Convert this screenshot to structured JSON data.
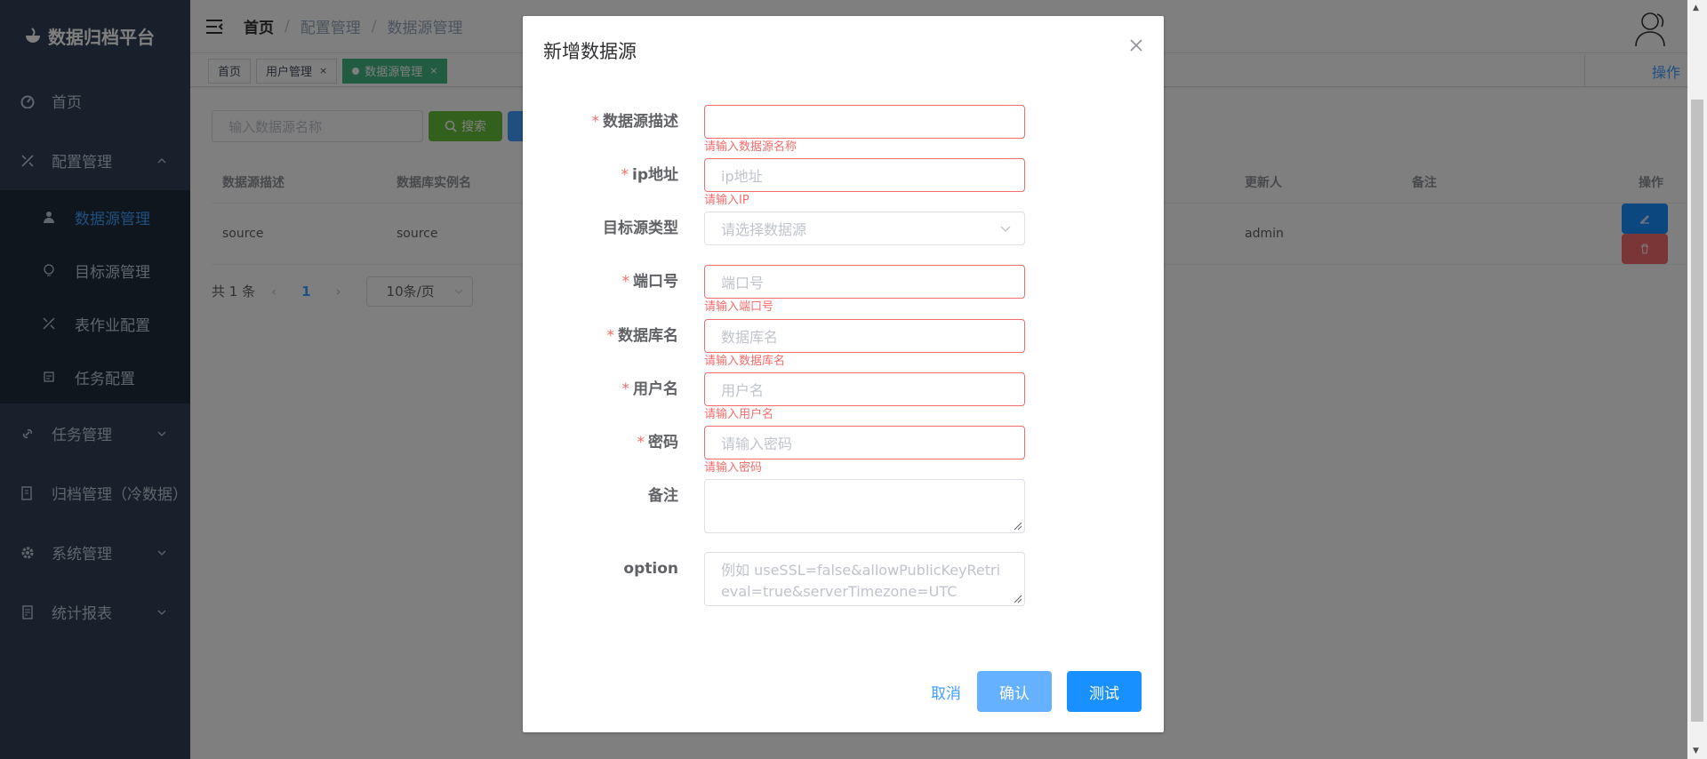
{
  "app": {
    "title": "数据归档平台"
  },
  "sidebar": {
    "items": [
      {
        "label": "首页",
        "icon": "dashboard-icon"
      },
      {
        "label": "配置管理",
        "icon": "tools-icon"
      },
      {
        "label": "任务管理",
        "icon": "link-icon"
      },
      {
        "label": "归档管理（冷数据）",
        "icon": "archive-icon"
      },
      {
        "label": "系统管理",
        "icon": "gear-icon"
      },
      {
        "label": "统计报表",
        "icon": "report-icon"
      }
    ],
    "submenu": [
      {
        "label": "数据源管理",
        "icon": "user-icon",
        "active": true
      },
      {
        "label": "目标源管理",
        "icon": "target-icon"
      },
      {
        "label": "表作业配置",
        "icon": "tools-icon"
      },
      {
        "label": "任务配置",
        "icon": "task-icon"
      }
    ]
  },
  "navbar": {
    "breadcrumb": [
      "首页",
      "配置管理",
      "数据源管理"
    ],
    "separator": "/"
  },
  "tags": {
    "items": [
      "首页",
      "用户管理",
      "数据源管理"
    ],
    "close": "×",
    "right_label": "操作"
  },
  "content": {
    "search_placeholder": "输入数据源名称",
    "search_button": "搜索",
    "table": {
      "headers": [
        "数据源描述",
        "数据库实例名",
        "更新人",
        "备注",
        "操作"
      ],
      "rows": [
        {
          "desc": "source",
          "instance": "source",
          "updater": "admin",
          "remark": ""
        }
      ]
    },
    "pagination": {
      "total": "共 1 条",
      "prev": "‹",
      "page": "1",
      "next": "›",
      "size": "10条/页"
    }
  },
  "dialog": {
    "title": "新增数据源",
    "close": "×",
    "fields": {
      "desc": {
        "label": "数据源描述",
        "required": "*",
        "value": "",
        "error": "请输入数据源名称"
      },
      "ip": {
        "label": "ip地址",
        "required": "*",
        "placeholder": "ip地址",
        "error": "请输入IP"
      },
      "type": {
        "label": "目标源类型",
        "placeholder": "请选择数据源"
      },
      "port": {
        "label": "端口号",
        "required": "*",
        "placeholder": "端口号",
        "error": "请输入端口号"
      },
      "dbname": {
        "label": "数据库名",
        "required": "*",
        "placeholder": "数据库名",
        "error": "请输入数据库名"
      },
      "username": {
        "label": "用户名",
        "required": "*",
        "placeholder": "用户名",
        "error": "请输入用户名"
      },
      "password": {
        "label": "密码",
        "required": "*",
        "placeholder": "请输入密码",
        "error": "请输入密码"
      },
      "remark": {
        "label": "备注",
        "placeholder": ""
      },
      "option": {
        "label": "option",
        "placeholder": "例如 useSSL=false&allowPublicKeyRetrieval=true&serverTimezone=UTC"
      }
    },
    "footer": {
      "cancel": "取消",
      "confirm": "确认",
      "test": "测试"
    }
  },
  "colors": {
    "primary": "#409eff",
    "danger": "#f56c6c",
    "success": "#67c23a",
    "sidebar": "#304156",
    "tag_active": "#42b983"
  }
}
